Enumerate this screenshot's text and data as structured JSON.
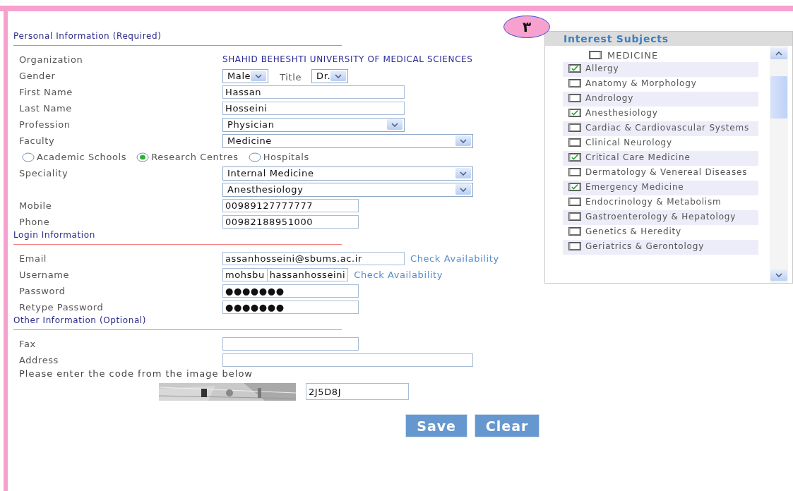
{
  "badge": "۳",
  "sections": [
    {
      "title": "Personal Information (Required)",
      "rows": [
        {
          "kind": "text",
          "label": "Organization",
          "value": "SHAHID BEHESHTI UNIVERSITY OF MEDICAL SCIENCES"
        },
        {
          "kind": "selectpair",
          "label": "Gender",
          "value": "Male",
          "label2": "Title",
          "value2": "Dr."
        },
        {
          "kind": "input",
          "label": "First Name",
          "value": "Hassan"
        },
        {
          "kind": "input",
          "label": "Last Name",
          "value": "Hosseini"
        },
        {
          "kind": "select",
          "label": "Profession",
          "value": "Physician"
        },
        {
          "kind": "wideselect",
          "label": "Faculty",
          "value": "Medicine"
        },
        {
          "kind": "radios",
          "options": [
            {
              "label": "Academic Schools",
              "selected": false
            },
            {
              "label": "Research Centres",
              "selected": true
            },
            {
              "label": "Hospitals",
              "selected": false
            }
          ]
        },
        {
          "kind": "wideselect",
          "label": "Speciality",
          "value": "Internal Medicine"
        },
        {
          "kind": "wideselect",
          "value": "Anesthesiology"
        },
        {
          "kind": "short",
          "label": "Mobile",
          "value": "00989127777777"
        },
        {
          "kind": "short",
          "label": "Phone",
          "value": "00982188951000"
        }
      ]
    },
    {
      "title": "Login Information",
      "rows": [
        {
          "kind": "email",
          "label": "Email",
          "value": "assanhosseini@sbums.ac.ir",
          "link": "Check Availability"
        },
        {
          "kind": "username",
          "label": "Username",
          "value": "mohsbu",
          "value2": "hassanhosseini",
          "link": "Check Availability"
        },
        {
          "kind": "short",
          "label": "Password",
          "value": "●●●●●●●"
        },
        {
          "kind": "short",
          "label": "Retype Password",
          "value": "●●●●●●●"
        }
      ]
    },
    {
      "title": "Other Information (Optional)",
      "rows": [
        {
          "kind": "short",
          "label": "Fax"
        },
        {
          "kind": "wide",
          "label": "Address"
        },
        {
          "kind": "note",
          "label": "Please enter the code from the image below"
        },
        {
          "kind": "captcha",
          "value": "2J5D8J"
        }
      ]
    }
  ],
  "buttons": [
    "Save",
    "Clear"
  ],
  "interest_subjects": {
    "title": "Interest Subjects",
    "group": {
      "label": "MEDICINE",
      "checked": false
    },
    "items": [
      {
        "label": "Allergy",
        "checked": true
      },
      {
        "label": "Anatomy & Morphology",
        "checked": false
      },
      {
        "label": "Andrology",
        "checked": false
      },
      {
        "label": "Anesthesiology",
        "checked": true
      },
      {
        "label": "Cardiac & Cardiovascular Systems",
        "checked": false
      },
      {
        "label": "Clinical Neurology",
        "checked": false
      },
      {
        "label": "Critical Care Medicine",
        "checked": true
      },
      {
        "label": "Dermatology & Venereal Diseases",
        "checked": false
      },
      {
        "label": "Emergency Medicine",
        "checked": true
      },
      {
        "label": "Endocrinology & Metabolism",
        "checked": false
      },
      {
        "label": "Gastroenterology & Hepatology",
        "checked": false
      },
      {
        "label": "Genetics & Heredity",
        "checked": false
      },
      {
        "label": "Geriatrics & Gerontology",
        "checked": false
      }
    ]
  }
}
